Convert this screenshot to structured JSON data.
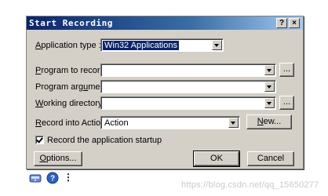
{
  "dialog": {
    "title": "Start Recording",
    "help_label": "?",
    "close_label": "×"
  },
  "form": {
    "application_type": {
      "label_key": "A",
      "label_rest": "pplication type :",
      "value": "Win32 Applications"
    },
    "program_to_record": {
      "label_key": "P",
      "label_rest": "rogram to record :",
      "value": "",
      "browse_label": "..."
    },
    "program_arguments": {
      "label_pre": "Program arg",
      "label_key": "u",
      "label_rest": "ments :",
      "value": ""
    },
    "working_directory": {
      "label_key": "W",
      "label_rest": "orking directory :",
      "value": "",
      "browse_label": "..."
    },
    "record_into_action": {
      "label_key": "R",
      "label_rest": "ecord into Action:",
      "value": "Action",
      "new_label_key": "N",
      "new_label_rest": "ew..."
    },
    "record_startup": {
      "label": "Record the application startup",
      "checked": true
    }
  },
  "buttons": {
    "options_key": "O",
    "options_rest": "ptions...",
    "ok": "OK",
    "cancel": "Cancel"
  },
  "toolbar": {
    "icons": [
      "record-icon",
      "help-icon",
      "more-icon"
    ],
    "more_label": "⋮"
  },
  "watermark": "https://blog.csdn.net/qq_15650277",
  "colors": {
    "dialog_face": "#d4d0c8",
    "titlebar_start": "#0a246a",
    "titlebar_end": "#a6caf0",
    "selection": "#0a246a"
  }
}
